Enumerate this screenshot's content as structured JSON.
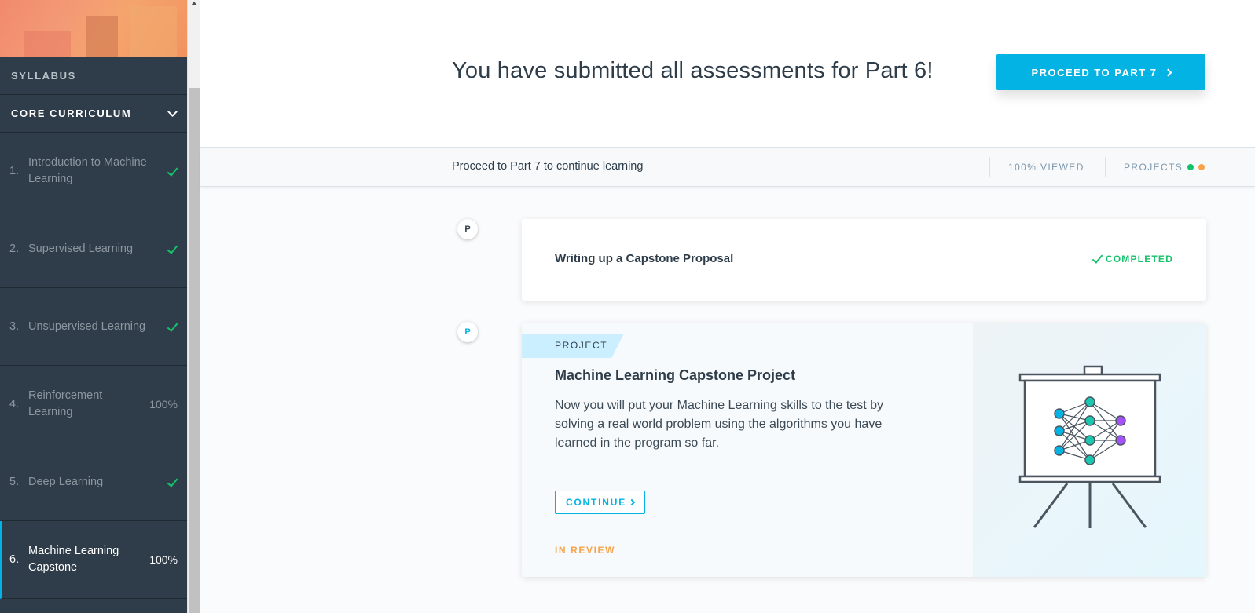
{
  "sidebar": {
    "syllabus_label": "SYLLABUS",
    "section_label": "CORE CURRICULUM",
    "lessons": [
      {
        "num": "1.",
        "title": "Introduction to Machine Learning",
        "status": "check"
      },
      {
        "num": "2.",
        "title": "Supervised Learning",
        "status": "check"
      },
      {
        "num": "3.",
        "title": "Unsupervised Learning",
        "status": "check"
      },
      {
        "num": "4.",
        "title": "Reinforcement Learning",
        "status": "100%"
      },
      {
        "num": "5.",
        "title": "Deep Learning",
        "status": "check"
      },
      {
        "num": "6.",
        "title": "Machine Learning Capstone",
        "status": "100%"
      }
    ]
  },
  "banner": {
    "heading": "You have submitted all assessments for Part 6!",
    "proceed_label": "PROCEED TO PART 7",
    "subtext": "Proceed to Part 7 to continue learning",
    "viewed": "100% VIEWED",
    "projects_label": "PROJECTS",
    "project_dot_colors": [
      "#15c26b",
      "#f7a449"
    ]
  },
  "timeline": {
    "marker1": "P",
    "marker2": "P"
  },
  "card_proposal": {
    "title": "Writing up a Capstone Proposal",
    "status": "COMPLETED"
  },
  "card_project": {
    "tag": "PROJECT",
    "title": "Machine Learning Capstone Project",
    "description": "Now you will put your Machine Learning skills to the test by solving a real world problem using the algorithms you have learned in the program so far.",
    "continue_label": "CONTINUE",
    "review_status": "IN REVIEW"
  },
  "colors": {
    "accent": "#02b3e4",
    "success": "#15c26b",
    "warning": "#f7a449",
    "sidebar_bg": "#2e3d49"
  }
}
